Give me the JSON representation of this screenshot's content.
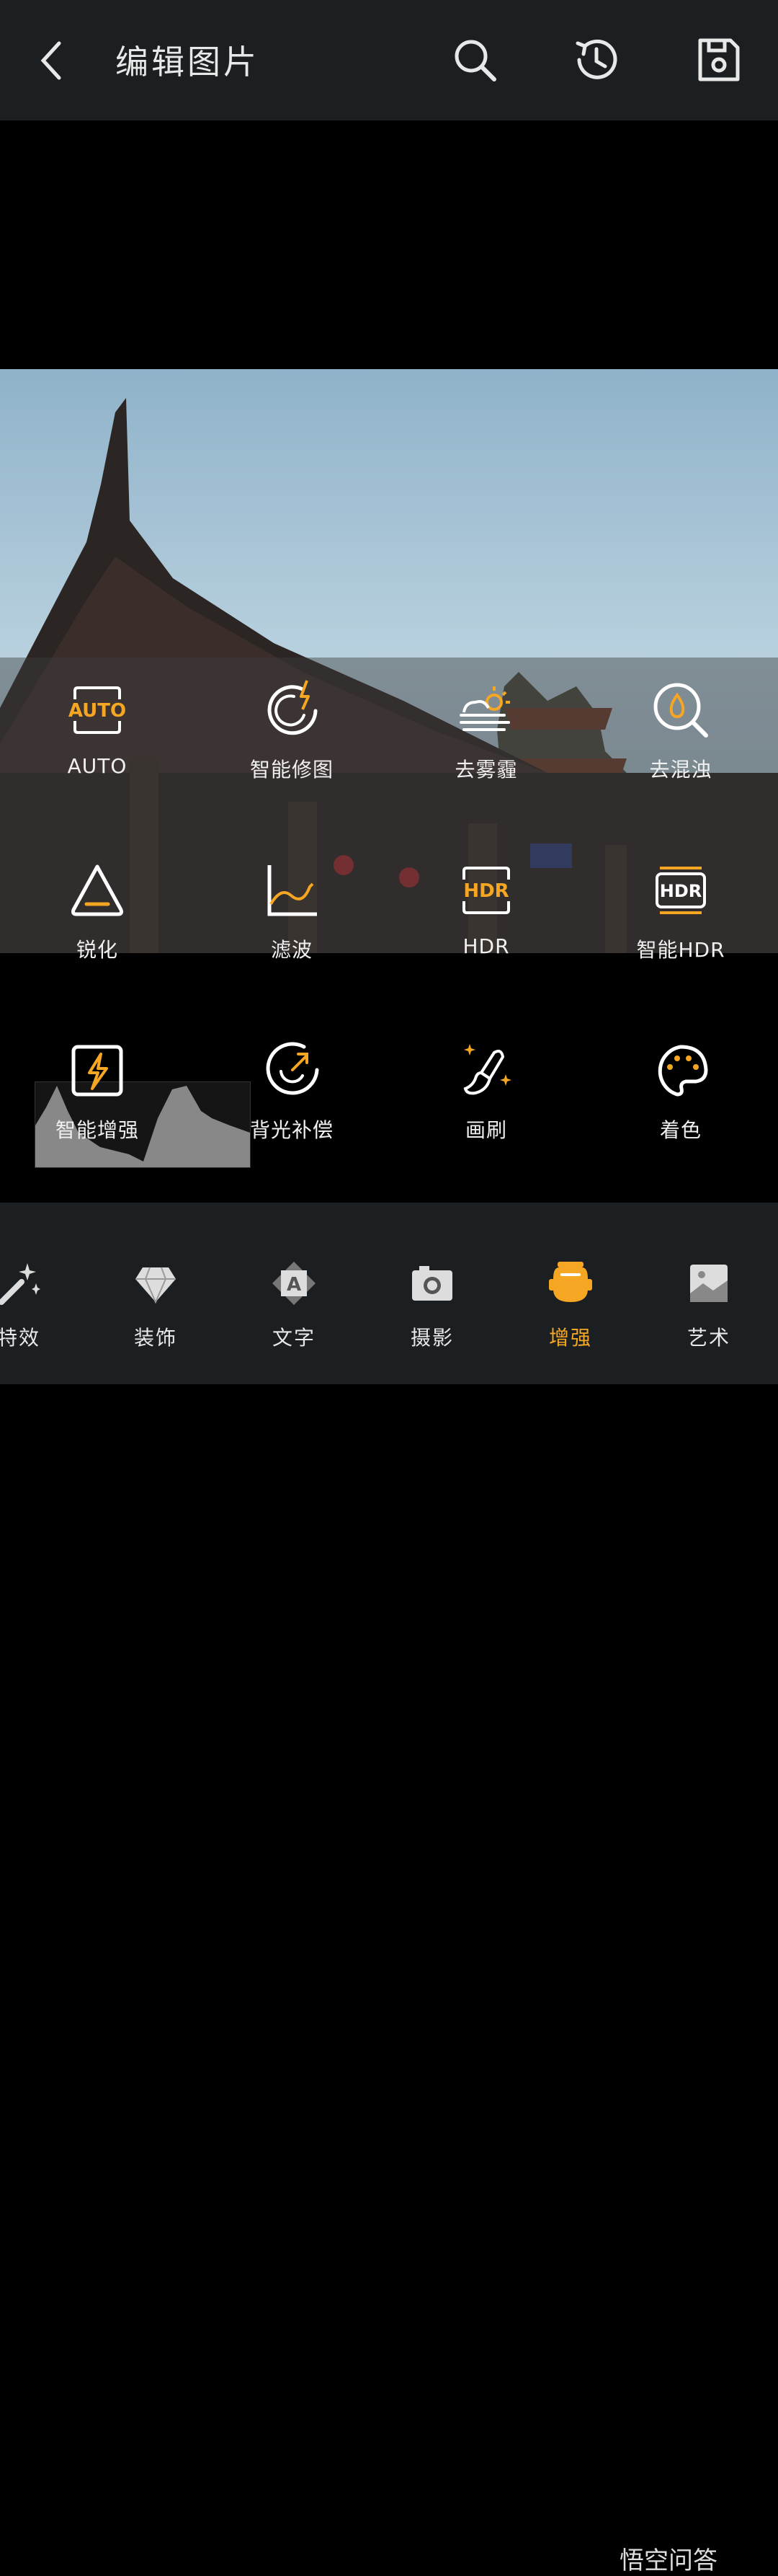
{
  "header": {
    "title": "编辑图片"
  },
  "colors": {
    "accent": "#f5a623",
    "bar_bg": "#1c1f21"
  },
  "tools": [
    {
      "label": "AUTO",
      "icon": "auto-icon"
    },
    {
      "label": "智能修图",
      "icon": "smart-retouch-icon"
    },
    {
      "label": "去雾霾",
      "icon": "dehaze-icon"
    },
    {
      "label": "去混浊",
      "icon": "deturbid-icon"
    },
    {
      "label": "锐化",
      "icon": "sharpen-icon"
    },
    {
      "label": "滤波",
      "icon": "filter-curve-icon"
    },
    {
      "label": "HDR",
      "icon": "hdr-icon"
    },
    {
      "label": "智能HDR",
      "icon": "smart-hdr-icon"
    },
    {
      "label": "智能增强",
      "icon": "smart-enhance-icon"
    },
    {
      "label": "背光补偿",
      "icon": "backlight-icon"
    },
    {
      "label": "画刷",
      "icon": "brush-icon"
    },
    {
      "label": "着色",
      "icon": "palette-icon"
    }
  ],
  "tabs": [
    {
      "label": "特效",
      "icon": "magic-wand-icon",
      "active": false
    },
    {
      "label": "装饰",
      "icon": "diamond-icon",
      "active": false
    },
    {
      "label": "文字",
      "icon": "text-icon",
      "active": false
    },
    {
      "label": "摄影",
      "icon": "camera-icon",
      "active": false
    },
    {
      "label": "增强",
      "icon": "enhance-robot-icon",
      "active": true
    },
    {
      "label": "艺术",
      "icon": "art-image-icon",
      "active": false
    }
  ],
  "watermark": "悟空问答"
}
